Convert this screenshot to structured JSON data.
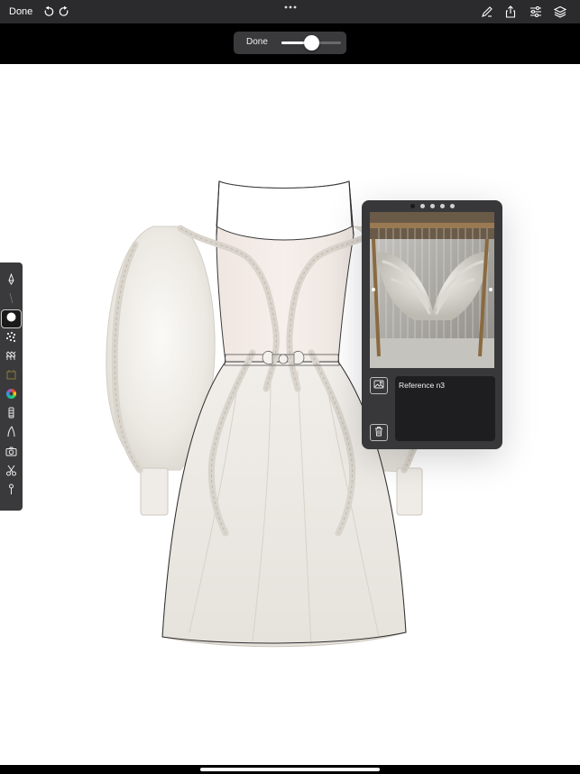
{
  "topbar": {
    "done_label": "Done",
    "left_icons": [
      "undo-icon",
      "redo-icon"
    ],
    "center_icon": "more-dots-icon",
    "right_icons": [
      "brush-settings-icon",
      "share-icon",
      "adjustments-icon",
      "layers-icon"
    ]
  },
  "slider": {
    "done_label": "Done",
    "value_fraction": 0.5
  },
  "toolbar": {
    "tools": [
      {
        "name": "pen-tool",
        "icon": "pen-icon",
        "active": false
      },
      {
        "name": "pencil-tool",
        "icon": "thin-stroke-icon",
        "active": false
      },
      {
        "name": "circle-brush-tool",
        "icon": "circle-icon",
        "active": true
      },
      {
        "name": "texture-brush-tool",
        "icon": "texture-icon",
        "active": false
      },
      {
        "name": "pattern-brush-tool",
        "icon": "pattern-icon",
        "active": false
      },
      {
        "name": "fabric-tool",
        "icon": "fabric-swatch-icon",
        "active": false
      },
      {
        "name": "color-wheel-tool",
        "icon": "color-wheel-icon",
        "active": false
      },
      {
        "name": "zipper-tool",
        "icon": "zipper-icon",
        "active": false
      },
      {
        "name": "curve-tool",
        "icon": "curve-icon",
        "active": false
      },
      {
        "name": "camera-tool",
        "icon": "camera-icon",
        "active": false
      },
      {
        "name": "scissors-tool",
        "icon": "scissors-icon",
        "active": false
      },
      {
        "name": "pin-tool",
        "icon": "pin-icon",
        "active": false
      }
    ]
  },
  "reference_panel": {
    "page_count": 5,
    "active_page": 0,
    "note_text": "Reference n3",
    "image_button_icon": "image-icon",
    "delete_button_icon": "trash-icon"
  },
  "colors": {
    "topbar": "#2b2b2d",
    "toolbar": "#3a3a3c",
    "panel": "#38383a",
    "note": "#1e1e20",
    "canvas": "#ffffff"
  }
}
